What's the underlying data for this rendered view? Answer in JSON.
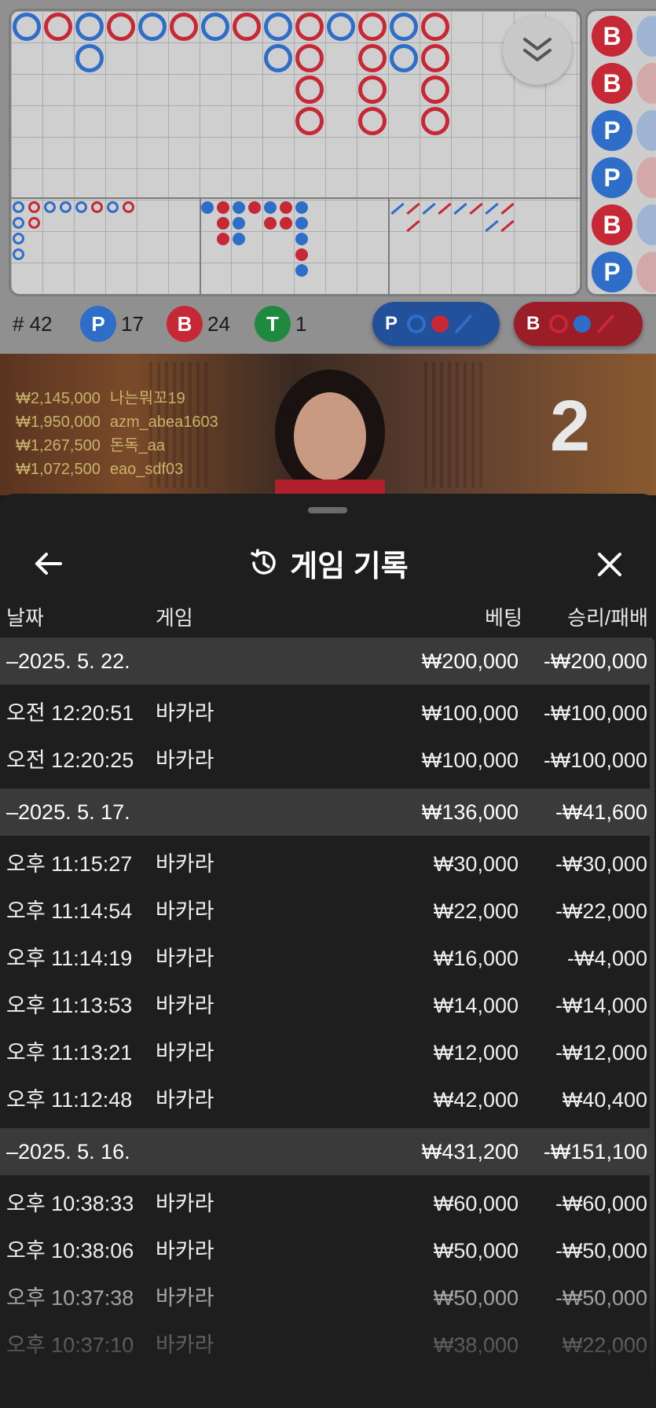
{
  "roadmap": {
    "big_road": [
      {
        "side": "b"
      },
      {
        "side": "r"
      },
      {
        "side": "b"
      },
      {
        "side": "r"
      },
      {
        "side": "b"
      },
      {
        "side": "r"
      },
      {
        "side": "b"
      },
      {
        "side": "r"
      },
      {
        "side": "b"
      },
      {
        "side": "r"
      },
      {
        "side": "b"
      },
      {
        "side": "r"
      },
      {
        "side": "b"
      },
      {
        "side": "r"
      }
    ],
    "side_road": [
      "B",
      "B",
      "P",
      "P",
      "B",
      "P"
    ],
    "stats": {
      "count_label": "# 42",
      "player_letter": "P",
      "player_count": "17",
      "banker_letter": "B",
      "banker_count": "24",
      "tie_letter": "T",
      "tie_count": "1"
    },
    "predict": {
      "player_letter": "P",
      "banker_letter": "B"
    }
  },
  "video": {
    "winners": [
      {
        "amount": "₩2,145,000",
        "name": "나는뭐꼬19"
      },
      {
        "amount": "₩1,950,000",
        "name": "azm_abea1603"
      },
      {
        "amount": "₩1,267,500",
        "name": "돈독_aa"
      },
      {
        "amount": "₩1,072,500",
        "name": "eao_sdf03"
      }
    ],
    "round_number": "2"
  },
  "sheet": {
    "title": "게임 기록",
    "columns": {
      "date": "날짜",
      "game": "게임",
      "bet": "베팅",
      "result": "승리/패배"
    },
    "groups": [
      {
        "date": "–2025. 5. 22.",
        "bet": "₩200,000",
        "result": "-₩200,000",
        "rows": [
          {
            "time": "오전 12:20:51",
            "game": "바카라",
            "bet": "₩100,000",
            "result": "-₩100,000"
          },
          {
            "time": "오전 12:20:25",
            "game": "바카라",
            "bet": "₩100,000",
            "result": "-₩100,000"
          }
        ]
      },
      {
        "date": "–2025. 5. 17.",
        "bet": "₩136,000",
        "result": "-₩41,600",
        "rows": [
          {
            "time": "오후 11:15:27",
            "game": "바카라",
            "bet": "₩30,000",
            "result": "-₩30,000"
          },
          {
            "time": "오후 11:14:54",
            "game": "바카라",
            "bet": "₩22,000",
            "result": "-₩22,000"
          },
          {
            "time": "오후 11:14:19",
            "game": "바카라",
            "bet": "₩16,000",
            "result": "-₩4,000"
          },
          {
            "time": "오후 11:13:53",
            "game": "바카라",
            "bet": "₩14,000",
            "result": "-₩14,000"
          },
          {
            "time": "오후 11:13:21",
            "game": "바카라",
            "bet": "₩12,000",
            "result": "-₩12,000"
          },
          {
            "time": "오후 11:12:48",
            "game": "바카라",
            "bet": "₩42,000",
            "result": "₩40,400"
          }
        ]
      },
      {
        "date": "–2025. 5. 16.",
        "bet": "₩431,200",
        "result": "-₩151,100",
        "rows": [
          {
            "time": "오후 10:38:33",
            "game": "바카라",
            "bet": "₩60,000",
            "result": "-₩60,000"
          },
          {
            "time": "오후 10:38:06",
            "game": "바카라",
            "bet": "₩50,000",
            "result": "-₩50,000"
          },
          {
            "time": "오후 10:37:38",
            "game": "바카라",
            "bet": "₩50,000",
            "result": "-₩50,000"
          },
          {
            "time": "오후 10:37:10",
            "game": "바카라",
            "bet": "₩38,000",
            "result": "₩22,000"
          }
        ]
      }
    ]
  },
  "colors": {
    "banker": "#c62835",
    "player": "#2e6ec8",
    "tie": "#1f8a3e",
    "sheet_bg": "#1e1e1e",
    "group_bg": "#3a3a3a"
  },
  "icons": {
    "back": "arrow-left-icon",
    "history": "history-clock-icon",
    "close": "close-icon",
    "collapse": "chevron-double-down-icon"
  }
}
